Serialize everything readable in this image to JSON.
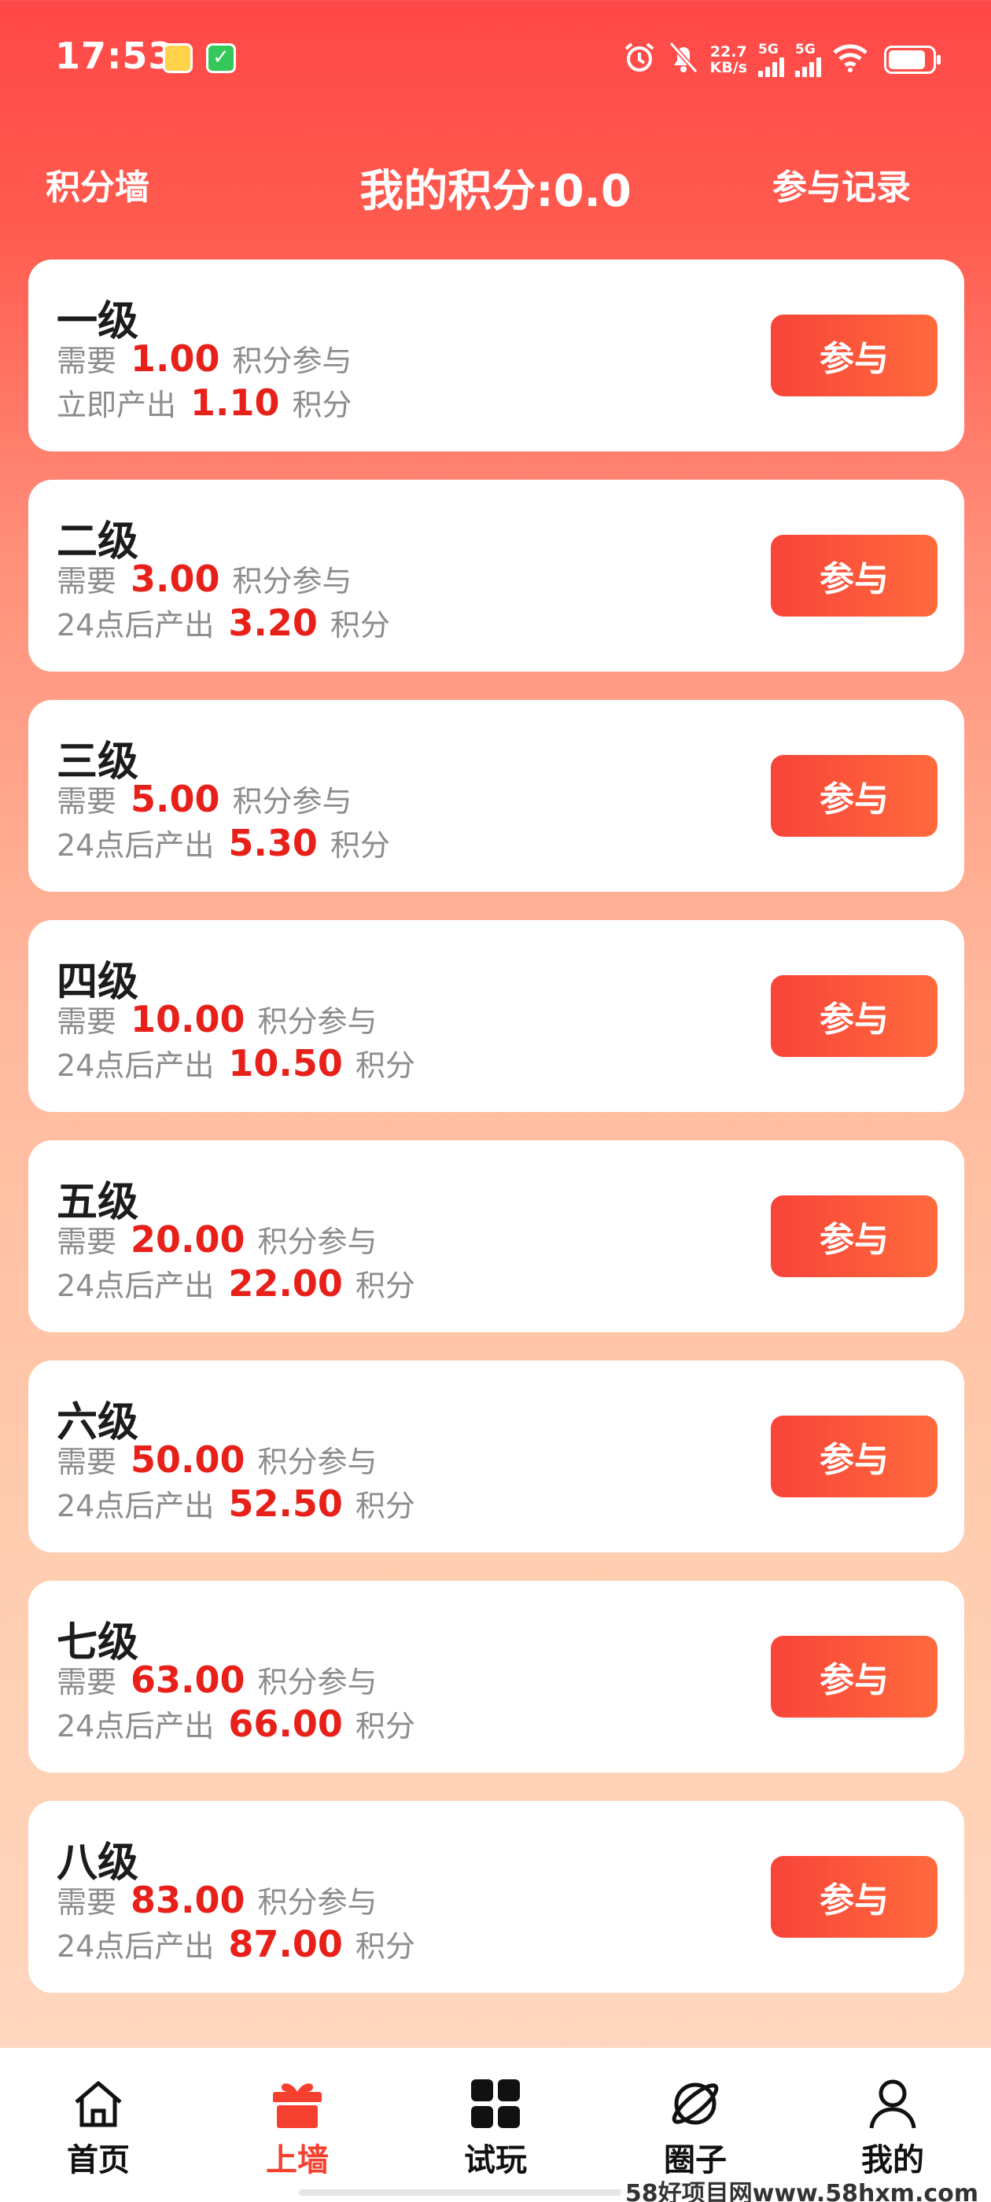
{
  "status_bar": {
    "time": "17:53",
    "network_speed_top": "22.7",
    "network_speed_bottom": "KB/s",
    "signal1_label": "5G",
    "signal2_label": "5G",
    "icons": [
      "alarm-icon",
      "mute-bell-icon",
      "wifi-icon",
      "battery-icon"
    ],
    "battery_level": 0.85
  },
  "header": {
    "left_label": "积分墙",
    "title": "我的积分:0.0",
    "right_label": "参与记录"
  },
  "levels": [
    {
      "name": "一级",
      "need_prefix": "需要",
      "need_value": "1.00",
      "need_suffix": "积分参与",
      "output_prefix": "立即产出",
      "output_value": "1.10",
      "output_suffix": "积分",
      "button": "参与"
    },
    {
      "name": "二级",
      "need_prefix": "需要",
      "need_value": "3.00",
      "need_suffix": "积分参与",
      "output_prefix": "24点后产出",
      "output_value": "3.20",
      "output_suffix": "积分",
      "button": "参与"
    },
    {
      "name": "三级",
      "need_prefix": "需要",
      "need_value": "5.00",
      "need_suffix": "积分参与",
      "output_prefix": "24点后产出",
      "output_value": "5.30",
      "output_suffix": "积分",
      "button": "参与"
    },
    {
      "name": "四级",
      "need_prefix": "需要",
      "need_value": "10.00",
      "need_suffix": "积分参与",
      "output_prefix": "24点后产出",
      "output_value": "10.50",
      "output_suffix": "积分",
      "button": "参与"
    },
    {
      "name": "五级",
      "need_prefix": "需要",
      "need_value": "20.00",
      "need_suffix": "积分参与",
      "output_prefix": "24点后产出",
      "output_value": "22.00",
      "output_suffix": "积分",
      "button": "参与"
    },
    {
      "name": "六级",
      "need_prefix": "需要",
      "need_value": "50.00",
      "need_suffix": "积分参与",
      "output_prefix": "24点后产出",
      "output_value": "52.50",
      "output_suffix": "积分",
      "button": "参与"
    },
    {
      "name": "七级",
      "need_prefix": "需要",
      "need_value": "63.00",
      "need_suffix": "积分参与",
      "output_prefix": "24点后产出",
      "output_value": "66.00",
      "output_suffix": "积分",
      "button": "参与"
    },
    {
      "name": "八级",
      "need_prefix": "需要",
      "need_value": "83.00",
      "need_suffix": "积分参与",
      "output_prefix": "24点后产出",
      "output_value": "87.00",
      "output_suffix": "积分",
      "button": "参与"
    }
  ],
  "tabbar": {
    "items": [
      {
        "label": "首页",
        "icon": "home-icon",
        "active": false
      },
      {
        "label": "上墙",
        "icon": "gift-icon",
        "active": true
      },
      {
        "label": "试玩",
        "icon": "grid-icon",
        "active": false
      },
      {
        "label": "圈子",
        "icon": "planet-icon",
        "active": false
      },
      {
        "label": "我的",
        "icon": "user-icon",
        "active": false
      }
    ]
  },
  "watermark": "58好项目网www.58hxm.com",
  "colors": {
    "accent": "#f5402f",
    "value_red": "#e8201a",
    "button_gradient_start": "#f8443a",
    "button_gradient_end": "#ff6a3c"
  }
}
